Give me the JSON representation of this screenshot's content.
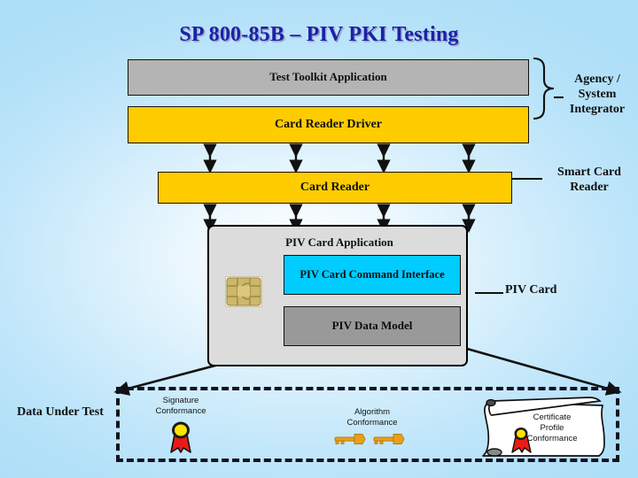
{
  "slide": {
    "title": "SP 800-85B – PIV PKI Testing",
    "title_color": "#1c21a8",
    "background_color": "#b3e2f8"
  },
  "stack": {
    "toolkit": {
      "label": "Test Toolkit Application",
      "color": "#b4b4b4"
    },
    "driver": {
      "label": "Card Reader Driver",
      "color": "#ffcc00"
    },
    "card_reader": {
      "label": "Card Reader",
      "color": "#ffcc00"
    }
  },
  "piv_card": {
    "title": "PIV Card Application",
    "chip_icon": "smart-card-chip-icon",
    "command_interface": {
      "label": "PIV Card Command Interface",
      "color": "#00ccff"
    },
    "data_model": {
      "label": "PIV Data Model",
      "color": "#999999"
    }
  },
  "annotations": {
    "agency": "Agency / System Integrator",
    "agency_lines": [
      "Agency /",
      "System",
      "Integrator"
    ],
    "smart_card_reader": "Smart Card Reader",
    "smart_card_reader_lines": [
      "Smart Card",
      "Reader"
    ],
    "piv_card": "PIV Card"
  },
  "data_under_test": {
    "label": "Data Under Test",
    "items": [
      {
        "label": "Signature Conformance",
        "lines": [
          "Signature",
          "Conformance"
        ],
        "icon": "award-ribbon-icon"
      },
      {
        "label": "Algorithm Conformance",
        "lines": [
          "Algorithm",
          "Conformance"
        ],
        "icon": "key-icon"
      },
      {
        "label": "Certificate Profile Conformance",
        "lines": [
          "Certificate",
          "Profile",
          "Conformance"
        ],
        "icon": "certificate-scroll-icon"
      }
    ]
  }
}
